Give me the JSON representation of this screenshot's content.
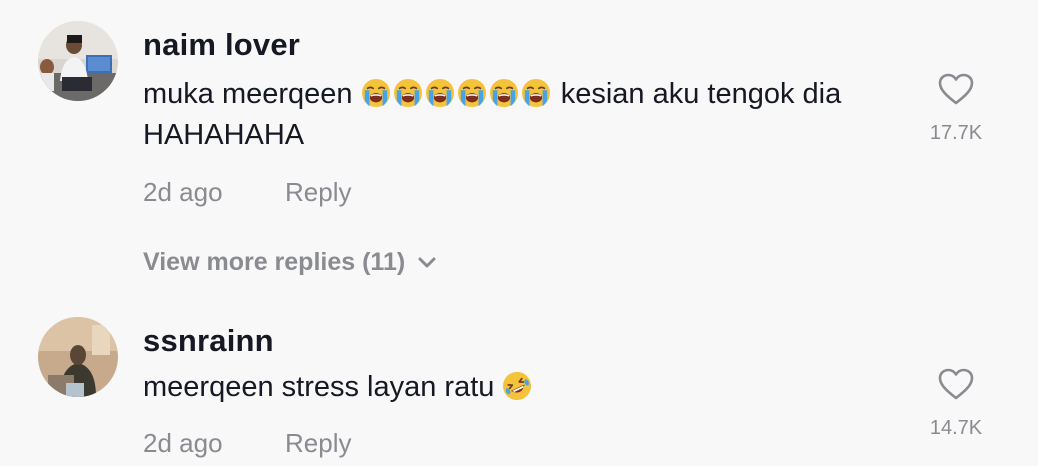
{
  "comments": [
    {
      "username": "naim lover",
      "text_before": "muka meerqeen",
      "emoji_before": [
        "loudly-crying-face-emoji",
        "loudly-crying-face-emoji",
        "loudly-crying-face-emoji",
        "loudly-crying-face-emoji",
        "loudly-crying-face-emoji",
        "loudly-crying-face-emoji"
      ],
      "text_after": "kesian aku tengok dia HAHAHAHA",
      "time": "2d ago",
      "reply_label": "Reply",
      "likes": "17.7K"
    },
    {
      "username": "ssnrainn",
      "text_before": "meerqeen stress layan ratu",
      "emoji_after": [
        "rolling-on-floor-laughing-emoji"
      ],
      "time": "2d ago",
      "reply_label": "Reply",
      "likes": "14.7K"
    }
  ],
  "view_more_replies": "View more replies (11)",
  "colors": {
    "background": "#f8f8f8",
    "primary_text": "#161823",
    "secondary_text": "#8a8b91"
  }
}
